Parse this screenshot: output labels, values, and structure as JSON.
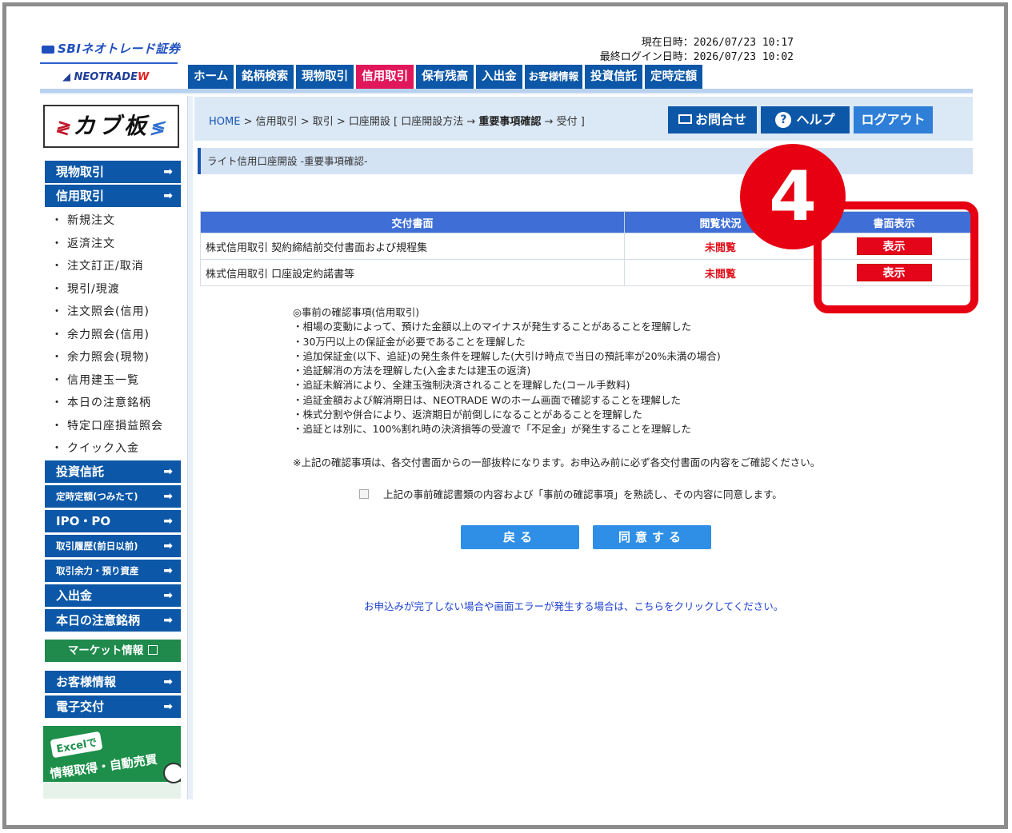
{
  "header": {
    "logo_sbi": "SBIネオトレード証券",
    "logo_neo": "NEOTRADE",
    "logo_neo_w": "W",
    "current_datetime_label": "現在日時：2026/07/23 10:17",
    "last_login_label": "最終ログイン日時：2026/07/23 10:02"
  },
  "topnav": {
    "tabs": [
      "ホーム",
      "銘柄検索",
      "現物取引",
      "信用取引",
      "保有残高",
      "入出金",
      "お客様情報",
      "投資信託",
      "定時定額"
    ]
  },
  "sidebar": {
    "kabu_label": "カブ板",
    "buttons": {
      "genbutsu": "現物取引",
      "shinyo": "信用取引",
      "toshin": "投資信託",
      "teiji": "定時定額(つみたて)",
      "ipo": "IPO・PO",
      "rireki": "取引履歴(前日以前)",
      "yoryoku": "取引余力・預り資産",
      "nyushukkin": "入出金",
      "chui": "本日の注意銘柄",
      "market": "マーケット情報",
      "okyakusama": "お客様情報",
      "denshi": "電子交付"
    },
    "arrow": "➡",
    "subitems": [
      "新規注文",
      "返済注文",
      "注文訂正/取消",
      "現引/現渡",
      "注文照会(信用)",
      "余力照会(信用)",
      "余力照会(現物)",
      "信用建玉一覧",
      "本日の注意銘柄",
      "特定口座損益照会",
      "クイック入金"
    ],
    "ad": {
      "excel": "Excelで",
      "text": "情報取得・自動売買"
    }
  },
  "breadcrumb": {
    "home": "HOME",
    "path": " > 信用取引 > 取引 > 口座開設 [ 口座開設方法 → ",
    "current": "重要事項確認",
    "tail": " → 受付 ]"
  },
  "header_buttons": {
    "contact": "お問合せ",
    "help": "ヘルプ",
    "logout": "ログアウト"
  },
  "section_title": "ライト信用口座開設 -重要事項確認-",
  "table": {
    "headers": [
      "交付書面",
      "閲覧状況",
      "書面表示"
    ],
    "rows": [
      {
        "doc": "株式信用取引  契約締結前交付書面および規程集",
        "status": "未閲覧",
        "action": "表示"
      },
      {
        "doc": "株式信用取引  口座設定約諾書等",
        "status": "未閲覧",
        "action": "表示"
      }
    ]
  },
  "callout_number": "4",
  "notes": [
    "◎事前の確認事項(信用取引)",
    "・相場の変動によって、預けた金額以上のマイナスが発生することがあることを理解した",
    "・30万円以上の保証金が必要であることを理解した",
    "・追加保証金(以下、追証)の発生条件を理解した(大引け時点で当日の預託率が20%未満の場合)",
    "・追証解消の方法を理解した(入金または建玉の返済)",
    "・追証未解消により、全建玉強制決済されることを理解した(コール手数料)",
    "・追証金額および解消期日は、NEOTRADE Wのホーム画面で確認することを理解した",
    "・株式分割や併合により、返済期日が前倒しになることがあることを理解した",
    "・追証とは別に、100%割れ時の決済損等の受渡で「不足金」が発生することを理解した"
  ],
  "disclaimer": "※上記の確認事項は、各交付書面からの一部抜粋になります。お申込み前に必ず各交付書面の内容をご確認ください。",
  "agree_label": "上記の事前確認書類の内容および「事前の確認事項」を熟読し、その内容に同意します。",
  "buttons": {
    "back": "戻る",
    "agree": "同意する"
  },
  "help_link": "お申込みが完了しない場合や画面エラーが発生する場合は、こちらをクリックしてください。",
  "colors": {
    "nav_blue": "#0c57a7",
    "active_pink": "#e0175a",
    "alert_red": "#e60012",
    "table_header": "#3f6fd6"
  }
}
